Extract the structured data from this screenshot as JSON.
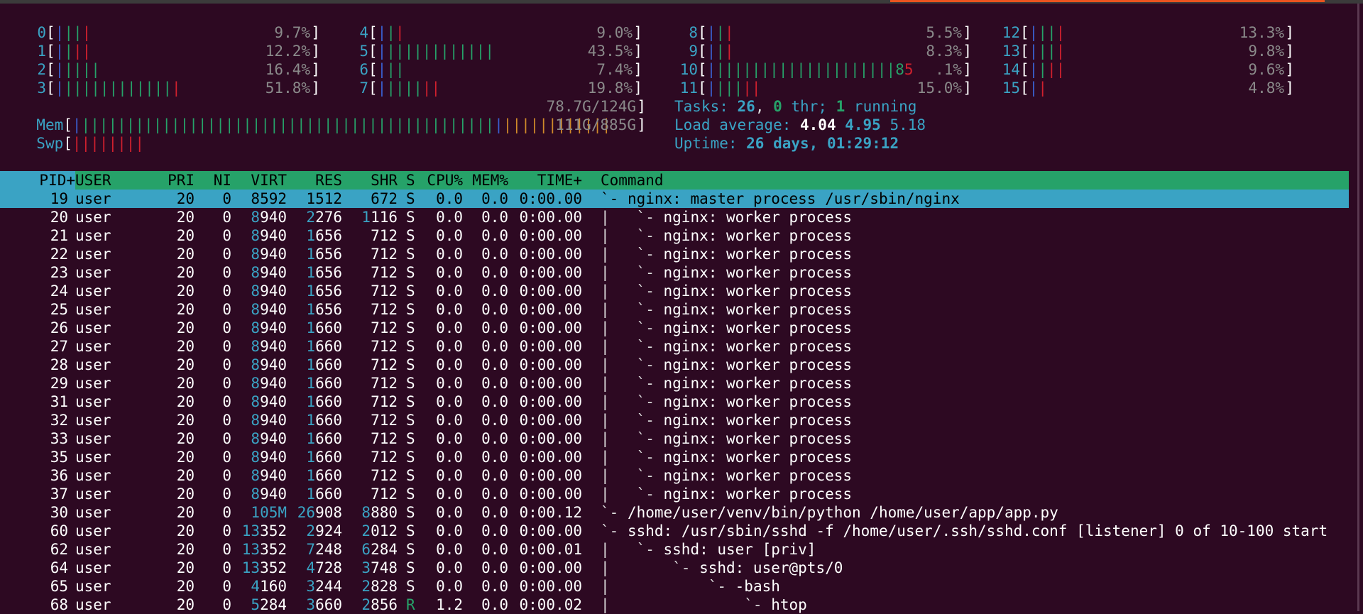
{
  "cpus": [
    {
      "id": "0",
      "bars": [
        {
          "t": "|",
          "c": "b-bl"
        },
        {
          "t": "||",
          "c": "b-gr"
        },
        {
          "t": "|",
          "c": "b-rd"
        }
      ],
      "pct": "9.7%"
    },
    {
      "id": "1",
      "bars": [
        {
          "t": "|",
          "c": "b-bl"
        },
        {
          "t": "|",
          "c": "b-gr"
        },
        {
          "t": "||",
          "c": "b-rd"
        }
      ],
      "pct": "12.2%"
    },
    {
      "id": "2",
      "bars": [
        {
          "t": "|",
          "c": "b-bl"
        },
        {
          "t": "||||",
          "c": "b-gr"
        }
      ],
      "pct": "16.4%"
    },
    {
      "id": "3",
      "bars": [
        {
          "t": "|",
          "c": "b-bl"
        },
        {
          "t": "||||||||||||",
          "c": "b-gr"
        },
        {
          "t": "|",
          "c": "b-rd"
        }
      ],
      "pct": "51.8%"
    },
    {
      "id": "4",
      "bars": [
        {
          "t": "|",
          "c": "b-bl"
        },
        {
          "t": "|",
          "c": "b-gr"
        },
        {
          "t": "|",
          "c": "b-rd"
        }
      ],
      "pct": "9.0%"
    },
    {
      "id": "5",
      "bars": [
        {
          "t": "|",
          "c": "b-bl"
        },
        {
          "t": "||||||||||||",
          "c": "b-gr"
        }
      ],
      "pct": "43.5%"
    },
    {
      "id": "6",
      "bars": [
        {
          "t": "|",
          "c": "b-bl"
        },
        {
          "t": "||",
          "c": "b-gr"
        }
      ],
      "pct": "7.4%"
    },
    {
      "id": "7",
      "bars": [
        {
          "t": "|",
          "c": "b-bl"
        },
        {
          "t": "||||",
          "c": "b-gr"
        },
        {
          "t": "||",
          "c": "b-rd"
        }
      ],
      "pct": "19.8%"
    },
    {
      "id": "8",
      "bars": [
        {
          "t": "|",
          "c": "b-bl"
        },
        {
          "t": "|",
          "c": "b-gr"
        },
        {
          "t": "|",
          "c": "b-rd"
        }
      ],
      "pct": "5.5%"
    },
    {
      "id": "9",
      "bars": [
        {
          "t": "|",
          "c": "b-bl"
        },
        {
          "t": "|",
          "c": "b-gr"
        },
        {
          "t": "|",
          "c": "b-rd"
        }
      ],
      "pct": "8.3%"
    },
    {
      "id": "10",
      "bars": [
        {
          "t": "|",
          "c": "b-bl"
        },
        {
          "t": "||||||||||||||||||||",
          "c": "b-gr"
        },
        {
          "t": "8",
          "c": "b-gr"
        },
        {
          "t": "5",
          "c": "b-rd"
        }
      ],
      "pct": ".1%"
    },
    {
      "id": "11",
      "bars": [
        {
          "t": "|",
          "c": "b-bl"
        },
        {
          "t": "|||",
          "c": "b-gr"
        },
        {
          "t": "||",
          "c": "b-rd"
        }
      ],
      "pct": "15.0%"
    },
    {
      "id": "12",
      "bars": [
        {
          "t": "|",
          "c": "b-bl"
        },
        {
          "t": "||",
          "c": "b-gr"
        },
        {
          "t": "|",
          "c": "b-rd"
        }
      ],
      "pct": "13.3%"
    },
    {
      "id": "13",
      "bars": [
        {
          "t": "|",
          "c": "b-bl"
        },
        {
          "t": "||",
          "c": "b-gr"
        },
        {
          "t": "|",
          "c": "b-rd"
        }
      ],
      "pct": "9.8%"
    },
    {
      "id": "14",
      "bars": [
        {
          "t": "|",
          "c": "b-bl"
        },
        {
          "t": "|",
          "c": "b-gr"
        },
        {
          "t": "||",
          "c": "b-rd"
        }
      ],
      "pct": "9.6%"
    },
    {
      "id": "15",
      "bars": [
        {
          "t": "|",
          "c": "b-bl"
        },
        {
          "t": "|",
          "c": "b-rd"
        }
      ],
      "pct": "4.8%"
    }
  ],
  "mem": {
    "label": "Mem",
    "bars": [
      {
        "t": "|",
        "c": "b-bl"
      },
      {
        "t": "||||||||||||||||||||||||||||||||||||||||||||||",
        "c": "b-gr"
      },
      {
        "t": "|",
        "c": "b-bl"
      },
      {
        "t": "||||||||||||",
        "c": "b-or"
      }
    ],
    "value": "78.7G/124G"
  },
  "swp": {
    "label": "Swp",
    "bars": [
      {
        "t": "||||||||",
        "c": "b-rd"
      }
    ],
    "value": "111G/885G"
  },
  "tasks": {
    "label": "Tasks: ",
    "count": "26",
    "sep1": ", ",
    "thr": "0",
    "thr_label": " thr; ",
    "running": "1",
    "running_label": " running"
  },
  "load": {
    "label": "Load average: ",
    "l1": "4.04",
    "l5": "4.95",
    "l15": "5.18"
  },
  "uptime": {
    "label": "Uptime: ",
    "value": "26 days, 01:29:12"
  },
  "columns": {
    "pid": "PID+",
    "user": "USER",
    "pri": "PRI",
    "ni": "NI",
    "virt": "VIRT",
    "res": "RES",
    "shr": "SHR",
    "s": "S",
    "cpu": "CPU%",
    "mem": "MEM%",
    "time": "TIME+",
    "command": "Command"
  },
  "processes": [
    {
      "pid": "19",
      "user": "user",
      "pri": "20",
      "ni": "0",
      "virt": "8592",
      "res": "1512",
      "shr": "672",
      "s": "S",
      "cpu": "0.0",
      "mem": "0.0",
      "time": "0:00.00",
      "tree": "`- ",
      "cmd": "nginx: master process /usr/sbin/nginx"
    },
    {
      "pid": "20",
      "user": "user",
      "pri": "20",
      "ni": "0",
      "virt": "8940",
      "res": "2276",
      "shr": "1116",
      "s": "S",
      "cpu": "0.0",
      "mem": "0.0",
      "time": "0:00.00",
      "tree": "|   `- ",
      "cmd": "nginx: worker process"
    },
    {
      "pid": "21",
      "user": "user",
      "pri": "20",
      "ni": "0",
      "virt": "8940",
      "res": "1656",
      "shr": "712",
      "s": "S",
      "cpu": "0.0",
      "mem": "0.0",
      "time": "0:00.00",
      "tree": "|   `- ",
      "cmd": "nginx: worker process"
    },
    {
      "pid": "22",
      "user": "user",
      "pri": "20",
      "ni": "0",
      "virt": "8940",
      "res": "1656",
      "shr": "712",
      "s": "S",
      "cpu": "0.0",
      "mem": "0.0",
      "time": "0:00.00",
      "tree": "|   `- ",
      "cmd": "nginx: worker process"
    },
    {
      "pid": "23",
      "user": "user",
      "pri": "20",
      "ni": "0",
      "virt": "8940",
      "res": "1656",
      "shr": "712",
      "s": "S",
      "cpu": "0.0",
      "mem": "0.0",
      "time": "0:00.00",
      "tree": "|   `- ",
      "cmd": "nginx: worker process"
    },
    {
      "pid": "24",
      "user": "user",
      "pri": "20",
      "ni": "0",
      "virt": "8940",
      "res": "1656",
      "shr": "712",
      "s": "S",
      "cpu": "0.0",
      "mem": "0.0",
      "time": "0:00.00",
      "tree": "|   `- ",
      "cmd": "nginx: worker process"
    },
    {
      "pid": "25",
      "user": "user",
      "pri": "20",
      "ni": "0",
      "virt": "8940",
      "res": "1656",
      "shr": "712",
      "s": "S",
      "cpu": "0.0",
      "mem": "0.0",
      "time": "0:00.00",
      "tree": "|   `- ",
      "cmd": "nginx: worker process"
    },
    {
      "pid": "26",
      "user": "user",
      "pri": "20",
      "ni": "0",
      "virt": "8940",
      "res": "1660",
      "shr": "712",
      "s": "S",
      "cpu": "0.0",
      "mem": "0.0",
      "time": "0:00.00",
      "tree": "|   `- ",
      "cmd": "nginx: worker process"
    },
    {
      "pid": "27",
      "user": "user",
      "pri": "20",
      "ni": "0",
      "virt": "8940",
      "res": "1660",
      "shr": "712",
      "s": "S",
      "cpu": "0.0",
      "mem": "0.0",
      "time": "0:00.00",
      "tree": "|   `- ",
      "cmd": "nginx: worker process"
    },
    {
      "pid": "28",
      "user": "user",
      "pri": "20",
      "ni": "0",
      "virt": "8940",
      "res": "1660",
      "shr": "712",
      "s": "S",
      "cpu": "0.0",
      "mem": "0.0",
      "time": "0:00.00",
      "tree": "|   `- ",
      "cmd": "nginx: worker process"
    },
    {
      "pid": "29",
      "user": "user",
      "pri": "20",
      "ni": "0",
      "virt": "8940",
      "res": "1660",
      "shr": "712",
      "s": "S",
      "cpu": "0.0",
      "mem": "0.0",
      "time": "0:00.00",
      "tree": "|   `- ",
      "cmd": "nginx: worker process"
    },
    {
      "pid": "31",
      "user": "user",
      "pri": "20",
      "ni": "0",
      "virt": "8940",
      "res": "1660",
      "shr": "712",
      "s": "S",
      "cpu": "0.0",
      "mem": "0.0",
      "time": "0:00.00",
      "tree": "|   `- ",
      "cmd": "nginx: worker process"
    },
    {
      "pid": "32",
      "user": "user",
      "pri": "20",
      "ni": "0",
      "virt": "8940",
      "res": "1660",
      "shr": "712",
      "s": "S",
      "cpu": "0.0",
      "mem": "0.0",
      "time": "0:00.00",
      "tree": "|   `- ",
      "cmd": "nginx: worker process"
    },
    {
      "pid": "33",
      "user": "user",
      "pri": "20",
      "ni": "0",
      "virt": "8940",
      "res": "1660",
      "shr": "712",
      "s": "S",
      "cpu": "0.0",
      "mem": "0.0",
      "time": "0:00.00",
      "tree": "|   `- ",
      "cmd": "nginx: worker process"
    },
    {
      "pid": "35",
      "user": "user",
      "pri": "20",
      "ni": "0",
      "virt": "8940",
      "res": "1660",
      "shr": "712",
      "s": "S",
      "cpu": "0.0",
      "mem": "0.0",
      "time": "0:00.00",
      "tree": "|   `- ",
      "cmd": "nginx: worker process"
    },
    {
      "pid": "36",
      "user": "user",
      "pri": "20",
      "ni": "0",
      "virt": "8940",
      "res": "1660",
      "shr": "712",
      "s": "S",
      "cpu": "0.0",
      "mem": "0.0",
      "time": "0:00.00",
      "tree": "|   `- ",
      "cmd": "nginx: worker process"
    },
    {
      "pid": "37",
      "user": "user",
      "pri": "20",
      "ni": "0",
      "virt": "8940",
      "res": "1660",
      "shr": "712",
      "s": "S",
      "cpu": "0.0",
      "mem": "0.0",
      "time": "0:00.00",
      "tree": "|   `- ",
      "cmd": "nginx: worker process"
    },
    {
      "pid": "30",
      "user": "user",
      "pri": "20",
      "ni": "0",
      "virt": "105M",
      "res": "26908",
      "shr": "8880",
      "s": "S",
      "cpu": "0.0",
      "mem": "0.0",
      "time": "0:00.12",
      "tree": "`- ",
      "cmd": "/home/user/venv/bin/python /home/user/app/app.py"
    },
    {
      "pid": "60",
      "user": "user",
      "pri": "20",
      "ni": "0",
      "virt": "13352",
      "res": "2924",
      "shr": "2012",
      "s": "S",
      "cpu": "0.0",
      "mem": "0.0",
      "time": "0:00.00",
      "tree": "`- ",
      "cmd": "sshd: /usr/sbin/sshd -f /home/user/.ssh/sshd.conf [listener] 0 of 10-100 start"
    },
    {
      "pid": "62",
      "user": "user",
      "pri": "20",
      "ni": "0",
      "virt": "13352",
      "res": "7248",
      "shr": "6284",
      "s": "S",
      "cpu": "0.0",
      "mem": "0.0",
      "time": "0:00.01",
      "tree": "|   `- ",
      "cmd": "sshd: user [priv]"
    },
    {
      "pid": "64",
      "user": "user",
      "pri": "20",
      "ni": "0",
      "virt": "13352",
      "res": "4728",
      "shr": "3748",
      "s": "S",
      "cpu": "0.0",
      "mem": "0.0",
      "time": "0:00.00",
      "tree": "|       `- ",
      "cmd": "sshd: user@pts/0"
    },
    {
      "pid": "65",
      "user": "user",
      "pri": "20",
      "ni": "0",
      "virt": "4160",
      "res": "3244",
      "shr": "2828",
      "s": "S",
      "cpu": "0.0",
      "mem": "0.0",
      "time": "0:00.00",
      "tree": "|           `- ",
      "cmd": "-bash"
    },
    {
      "pid": "68",
      "user": "user",
      "pri": "20",
      "ni": "0",
      "virt": "5284",
      "res": "3660",
      "shr": "2856",
      "s": "R",
      "cpu": "1.2",
      "mem": "0.0",
      "time": "0:00.02",
      "tree": "|               `- ",
      "cmd": "htop"
    }
  ]
}
